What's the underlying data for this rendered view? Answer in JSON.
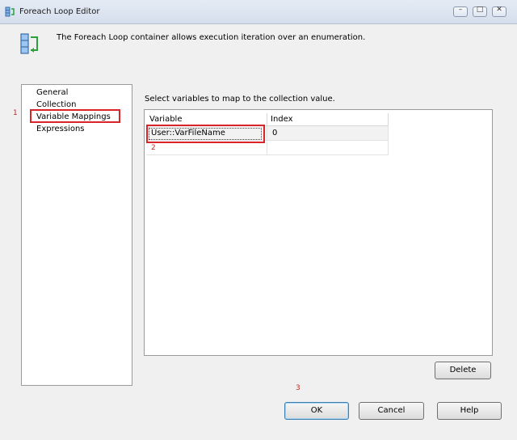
{
  "window": {
    "title": "Foreach Loop Editor",
    "controls": {
      "minimize": "–",
      "maximize": "□",
      "close": "✕"
    }
  },
  "header": {
    "description": "The Foreach Loop container allows execution iteration over an enumeration."
  },
  "nav": {
    "items": [
      {
        "label": "General"
      },
      {
        "label": "Collection"
      },
      {
        "label": "Variable Mappings",
        "selected": true
      },
      {
        "label": "Expressions"
      }
    ]
  },
  "mappings": {
    "instruction": "Select variables to map to the collection value.",
    "columns": [
      "Variable",
      "Index"
    ],
    "rows": [
      {
        "variable": "User::VarFileName",
        "index": "0"
      }
    ]
  },
  "annotations": [
    "1",
    "2",
    "3"
  ],
  "buttons": {
    "delete": "Delete",
    "ok": "OK",
    "cancel": "Cancel",
    "help": "Help"
  },
  "colors": {
    "annotation_red": "#d9242b",
    "icon_blue": "#4a90d9",
    "icon_green": "#2e9e3e"
  },
  "icons": {
    "title": "foreach-loop-icon",
    "header": "foreach-loop-icon"
  }
}
